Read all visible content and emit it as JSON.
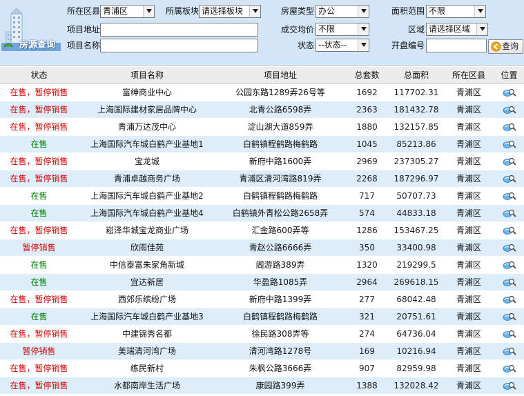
{
  "search": {
    "logo_text": "房源查询",
    "district_label": "所在区县",
    "district_value": "青浦区",
    "block_label": "所属板块",
    "block_value": "请选择板块",
    "house_type_label": "房屋类型",
    "house_type_value": "办公",
    "area_range_label": "面积范围",
    "area_range_value": "不限",
    "address_label": "项目地址",
    "address_value": "",
    "avg_price_label": "成交均价",
    "avg_price_value": "不限",
    "region_label": "区域",
    "region_value": "请选择区域",
    "name_label": "项目名称",
    "name_value": "",
    "status_label": "状态",
    "status_value": "--状态--",
    "open_no_label": "开盘编号",
    "open_no_value": "",
    "search_button": "查询"
  },
  "table": {
    "headers": [
      "状态",
      "项目名称",
      "项目地址",
      "总套数",
      "总面积",
      "所在区县",
      "位置"
    ],
    "rows": [
      {
        "status": "在售，暂停销售",
        "status_color": "#d60000",
        "name": "富绅商业中心",
        "address": "公园东路1289弄26号等",
        "units": "1692",
        "area": "117702.31",
        "district": "青浦区"
      },
      {
        "status": "在售，暂停销售",
        "status_color": "#d60000",
        "name": "上海国际建材家居品牌中心",
        "address": "北青公路6598弄",
        "units": "2363",
        "area": "181432.78",
        "district": "青浦区"
      },
      {
        "status": "在售，暂停销售",
        "status_color": "#d60000",
        "name": "青浦万达茂中心",
        "address": "淀山湖大道859弄",
        "units": "1880",
        "area": "132157.85",
        "district": "青浦区"
      },
      {
        "status": "在售",
        "status_color": "#007a00",
        "name": "上海国际汽车城白鹤产业基地1",
        "address": "白鹤镇程鹤路梅鹤路",
        "units": "1045",
        "area": "85213.86",
        "district": "青浦区"
      },
      {
        "status": "在售，暂停销售",
        "status_color": "#d60000",
        "name": "宝龙城",
        "address": "新府中路1600弄",
        "units": "2969",
        "area": "237305.27",
        "district": "青浦区"
      },
      {
        "status": "在售，暂停销售",
        "status_color": "#d60000",
        "name": "青浦卓越商务广场",
        "address": "青浦区清河湾路819弄",
        "units": "2268",
        "area": "187296.97",
        "district": "青浦区"
      },
      {
        "status": "在售",
        "status_color": "#007a00",
        "name": "上海国际汽车城白鹤产业基地2",
        "address": "白鹤镇程鹤路梅鹤路",
        "units": "717",
        "area": "50707.73",
        "district": "青浦区"
      },
      {
        "status": "在售",
        "status_color": "#007a00",
        "name": "上海国际汽车城白鹤产业基地4",
        "address": "白鹤镇外青松公路2658弄",
        "units": "574",
        "area": "44833.18",
        "district": "青浦区"
      },
      {
        "status": "在售，暂停销售",
        "status_color": "#d60000",
        "name": "崧泽华城宝龙商业广场",
        "address": "汇金路600弄等",
        "units": "1286",
        "area": "153467.25",
        "district": "青浦区"
      },
      {
        "status": "暂停销售",
        "status_color": "#d60000",
        "name": "欣雨佳苑",
        "address": "青赵公路6666弄",
        "units": "350",
        "area": "33400.98",
        "district": "青浦区"
      },
      {
        "status": "在售",
        "status_color": "#007a00",
        "name": "中信泰富朱家角新城",
        "address": "阁游路389弄",
        "units": "1320",
        "area": "219299.5",
        "district": "青浦区"
      },
      {
        "status": "在售",
        "status_color": "#007a00",
        "name": "宜达新居",
        "address": "华盈路1085弄",
        "units": "2964",
        "area": "269618.15",
        "district": "青浦区"
      },
      {
        "status": "在售，暂停销售",
        "status_color": "#d60000",
        "name": "西郊乐缤纷广场",
        "address": "新府中路1399弄",
        "units": "277",
        "area": "68042.48",
        "district": "青浦区"
      },
      {
        "status": "在售",
        "status_color": "#007a00",
        "name": "上海国际汽车城白鹤产业基地3",
        "address": "白鹤镇程鹤路梅鹤路",
        "units": "321",
        "area": "20751.61",
        "district": "青浦区"
      },
      {
        "status": "在售，暂停销售",
        "status_color": "#d60000",
        "name": "中建锦秀名都",
        "address": "徐民路308弄等",
        "units": "274",
        "area": "64736.04",
        "district": "青浦区"
      },
      {
        "status": "暂停销售",
        "status_color": "#d60000",
        "name": "美瑞清河湾广场",
        "address": "清河湾路1278号",
        "units": "169",
        "area": "10216.94",
        "district": "青浦区"
      },
      {
        "status": "在售，暂停销售",
        "status_color": "#d60000",
        "name": "练民新村",
        "address": "朱枫公路3666弄",
        "units": "907",
        "area": "82959.98",
        "district": "青浦区"
      },
      {
        "status": "在售，暂停销售",
        "status_color": "#d60000",
        "name": "水都南岸生活广场",
        "address": "康园路399弄",
        "units": "1388",
        "area": "132028.42",
        "district": "青浦区"
      }
    ]
  }
}
